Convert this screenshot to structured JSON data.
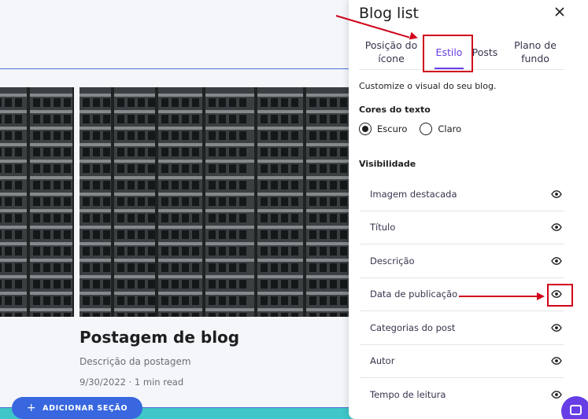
{
  "panel": {
    "title": "Blog list",
    "close_icon": "close-icon",
    "tabs": [
      {
        "label": "Posição do ícone",
        "active": false
      },
      {
        "label": "Estilo",
        "active": true
      },
      {
        "label": "Posts",
        "active": false
      },
      {
        "label": "Plano de fundo",
        "active": false
      }
    ],
    "intro": "Customize o visual do seu blog.",
    "text_colors": {
      "label": "Cores do texto",
      "options": [
        {
          "label": "Escuro",
          "selected": true
        },
        {
          "label": "Claro",
          "selected": false
        }
      ]
    },
    "visibility": {
      "label": "Visibilidade",
      "items": [
        {
          "label": "Imagem destacada",
          "icon": "eye-icon",
          "visible": true
        },
        {
          "label": "Título",
          "icon": "eye-icon",
          "visible": true
        },
        {
          "label": "Descrição",
          "icon": "eye-icon",
          "visible": true
        },
        {
          "label": "Data de publicação",
          "icon": "eye-icon",
          "visible": true
        },
        {
          "label": "Categorias do post",
          "icon": "eye-icon",
          "visible": true
        },
        {
          "label": "Autor",
          "icon": "eye-icon",
          "visible": true
        },
        {
          "label": "Tempo de leitura",
          "icon": "eye-icon",
          "visible": true
        }
      ]
    }
  },
  "canvas": {
    "post": {
      "title": "Postagem de blog",
      "description": "Descrição da postagem",
      "meta": "9/30/2022 · 1 min read"
    },
    "add_section_label": "ADICIONAR SEÇÃO",
    "add_section_icon": "plus-icon"
  },
  "colors": {
    "accent": "#673de6",
    "annotation": "#d0021b",
    "add_button": "#3867e0",
    "band": "#3fc6c8"
  }
}
